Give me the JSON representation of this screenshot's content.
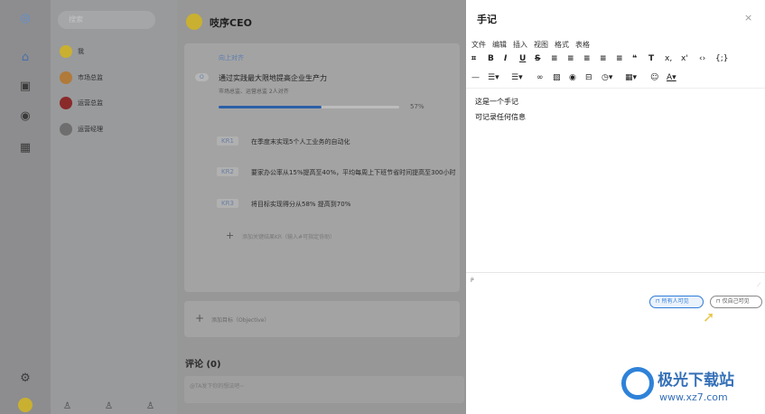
{
  "rail": {
    "icons": [
      "app-logo-icon",
      "home-icon",
      "clipboard-icon",
      "target-icon",
      "grid-icon",
      "settings-icon",
      "user-avatar"
    ]
  },
  "sidebar": {
    "search_placeholder": "搜索",
    "items": [
      {
        "label": "我"
      },
      {
        "label": "市场总监"
      },
      {
        "label": "运营总监"
      },
      {
        "label": "运营经理"
      }
    ]
  },
  "main": {
    "title": "吱序CEO",
    "okr": {
      "align_label": "向上对齐",
      "objective_num": "O",
      "objective": "通过实践最大限地提高企业生产力",
      "meta": "市场总监、运营总监  2人对齐",
      "progress_text": "57%",
      "progress": 0.57,
      "krs": [
        {
          "tag": "KR1",
          "text": "在季度末实现5个人工业务的自动化"
        },
        {
          "tag": "KR2",
          "text": "要家办公率从15%提高至40%，平均每周上下班节省时间提高至300小时"
        },
        {
          "tag": "KR3",
          "text": "将目标实现得分从58% 提高到70%"
        }
      ],
      "add_kr": "添加关键结果KR（输入#可指定协助）"
    },
    "add_objective": "添加目标（Objective）",
    "comments_title": "评论 (0)",
    "comment_placeholder": "@TA发下你的想法吧~"
  },
  "dialog": {
    "title": "手记",
    "menu": [
      "文件",
      "编辑",
      "插入",
      "视图",
      "格式",
      "表格"
    ],
    "content_lines": [
      "这是一个手记",
      "可记录任何信息"
    ],
    "status_path": "P",
    "perm_all": "所有人可见",
    "perm_self": "仅自己可见"
  },
  "watermark": {
    "cn": "极光下载站",
    "url": "www.xz7.com"
  },
  "colors": {
    "accent": "#2f7bd8",
    "progress": "#2c5fa8"
  }
}
